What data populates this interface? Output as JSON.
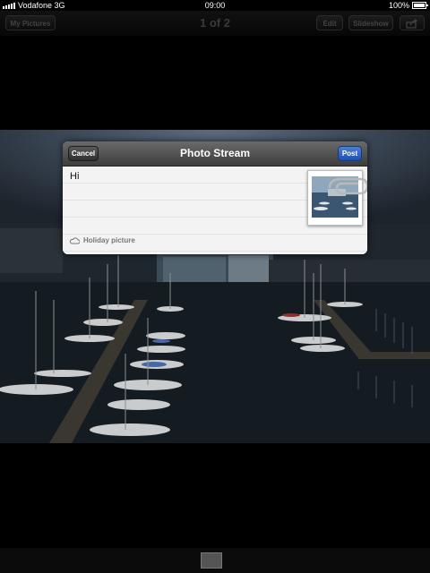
{
  "status_bar": {
    "carrier": "Vodafone 3G",
    "time": "09:00",
    "battery": "100%"
  },
  "toolbar": {
    "back_label": "My Pictures",
    "title": "1 of 2",
    "edit_label": "Edit",
    "slideshow_label": "Slideshow",
    "share_icon": "share-icon"
  },
  "dialog": {
    "title": "Photo Stream",
    "cancel_label": "Cancel",
    "post_label": "Post",
    "message": "Hi",
    "album_name": "Holiday picture",
    "album_icon": "cloud-icon",
    "attachment_icon": "paperclip-icon"
  },
  "bottom": {
    "thumbnail_icon": "photo-thumbnail-icon"
  }
}
